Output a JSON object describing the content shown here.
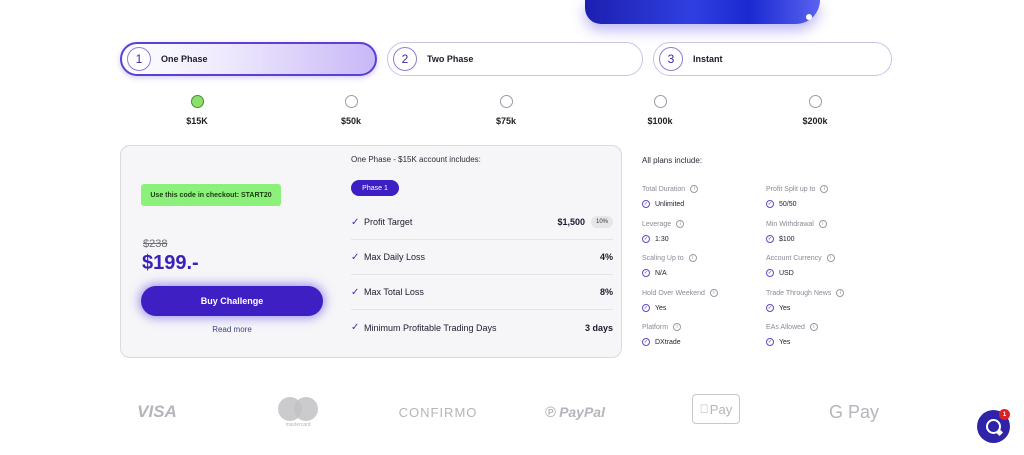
{
  "tabs": [
    {
      "num": "1",
      "label": "One Phase",
      "active": true
    },
    {
      "num": "2",
      "label": "Two Phase",
      "active": false
    },
    {
      "num": "3",
      "label": "Instant",
      "active": false
    }
  ],
  "amounts": [
    {
      "label": "$15K",
      "selected": true
    },
    {
      "label": "$50k",
      "selected": false
    },
    {
      "label": "$75k",
      "selected": false
    },
    {
      "label": "$100k",
      "selected": false
    },
    {
      "label": "$200k",
      "selected": false
    }
  ],
  "card": {
    "promo_text": "Use this code in checkout: START20",
    "old_price": "$238",
    "price": "$199.-",
    "buy_label": "Buy Challenge",
    "read_more": "Read more",
    "includes_title": "One Phase - $15K account includes:",
    "phase_pill": "Phase 1",
    "rules": [
      {
        "name": "Profit Target",
        "value": "$1,500",
        "badge": "10%"
      },
      {
        "name": "Max Daily Loss",
        "value": "4%"
      },
      {
        "name": "Max Total Loss",
        "value": "8%"
      },
      {
        "name": "Minimum Profitable Trading Days",
        "value": "3 days"
      }
    ]
  },
  "plans": {
    "title": "All plans include:",
    "features": [
      {
        "name": "Total Duration",
        "value": "Unlimited"
      },
      {
        "name": "Profit Split up to",
        "value": "50/50"
      },
      {
        "name": "Leverage",
        "value": "1:30"
      },
      {
        "name": "Min Withdrawal",
        "value": "$100"
      },
      {
        "name": "Scaling Up to",
        "value": "N/A"
      },
      {
        "name": "Account Currency",
        "value": "USD"
      },
      {
        "name": "Hold Over Weekend",
        "value": "Yes"
      },
      {
        "name": "Trade Through News",
        "value": "Yes"
      },
      {
        "name": "Platform",
        "value": "DXtrade"
      },
      {
        "name": "EAs Allowed",
        "value": "Yes"
      }
    ]
  },
  "payments": {
    "visa": "VISA",
    "mastercard": "mastercard",
    "confirmo": "CONFIRMO",
    "paypal": "PayPal",
    "applepay": "Pay",
    "googlepay": "G Pay"
  },
  "chat": {
    "badge": "1"
  },
  "colors": {
    "accent": "#3d1fc4",
    "promo": "#8cf17a",
    "selected_radio": "#8be06b",
    "price": "#3a22b8"
  }
}
